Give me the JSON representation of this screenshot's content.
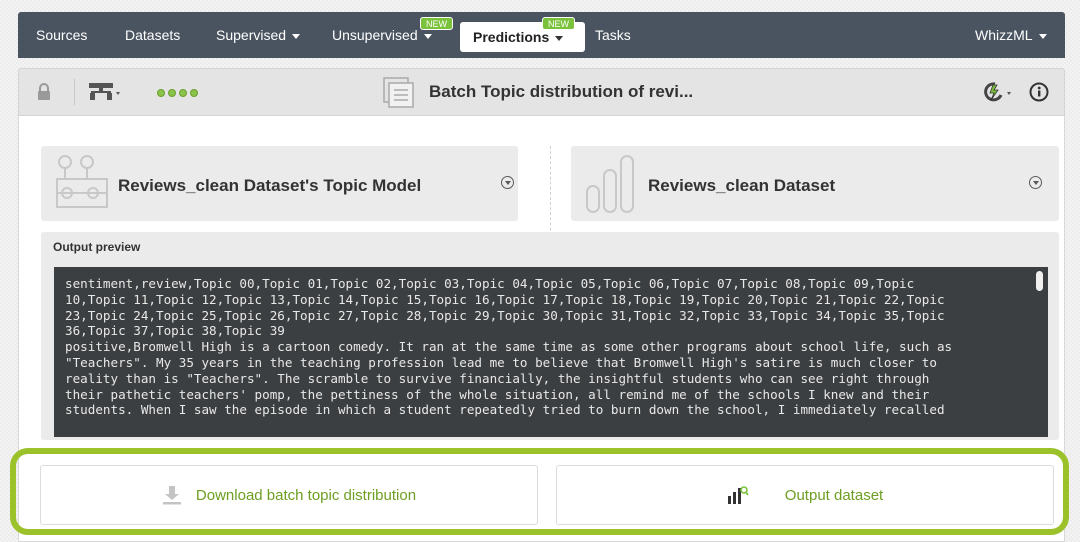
{
  "nav": {
    "sources": "Sources",
    "datasets": "Datasets",
    "supervised": "Supervised",
    "unsupervised": "Unsupervised",
    "predictions": "Predictions",
    "tasks": "Tasks",
    "whizzml": "WhizzML",
    "new_badge_1": "NEW",
    "new_badge_2": "NEW"
  },
  "toolbar": {
    "title": "Batch Topic distribution of revi..."
  },
  "cards": {
    "topic_model": "Reviews_clean Dataset's Topic Model",
    "dataset": "Reviews_clean Dataset"
  },
  "preview": {
    "label": "Output preview",
    "lines": [
      "sentiment,review,Topic 00,Topic 01,Topic 02,Topic 03,Topic 04,Topic 05,Topic 06,Topic 07,Topic 08,Topic 09,Topic",
      "10,Topic 11,Topic 12,Topic 13,Topic 14,Topic 15,Topic 16,Topic 17,Topic 18,Topic 19,Topic 20,Topic 21,Topic 22,Topic",
      "23,Topic 24,Topic 25,Topic 26,Topic 27,Topic 28,Topic 29,Topic 30,Topic 31,Topic 32,Topic 33,Topic 34,Topic 35,Topic",
      "36,Topic 37,Topic 38,Topic 39",
      "positive,Bromwell High is a cartoon comedy. It ran at the same time as some other programs about school life, such as",
      "\"Teachers\". My 35 years in the teaching profession lead me to believe that Bromwell High's satire is much closer to",
      "reality than is \"Teachers\". The scramble to survive financially, the insightful students who can see right through",
      "their pathetic teachers' pomp, the pettiness of the whole situation, all remind me of the schools I knew and their",
      "students. When I saw the episode in which a student repeatedly tried to burn down the school, I immediately recalled"
    ]
  },
  "actions": {
    "download": "Download batch topic distribution",
    "output_dataset": "Output dataset"
  },
  "colors": {
    "accent_green": "#9bc12b",
    "nav_bg": "#4a5460",
    "badge_green": "#7bc23c"
  }
}
